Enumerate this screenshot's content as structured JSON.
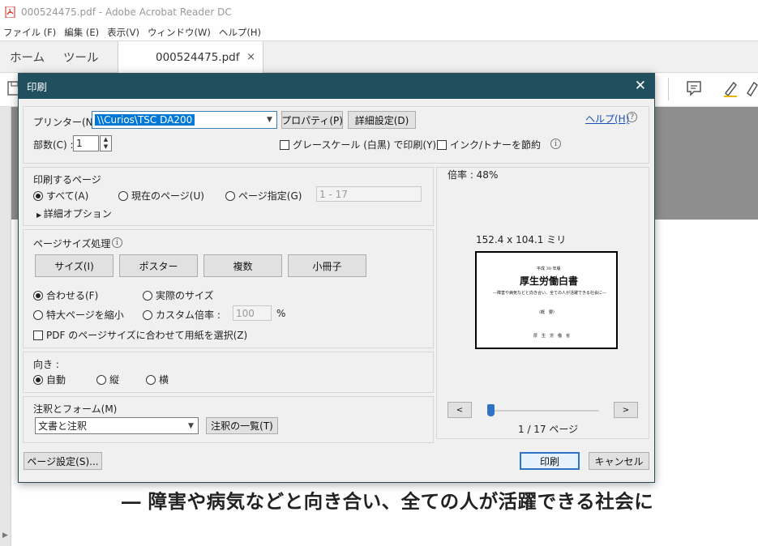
{
  "window": {
    "title": "000524475.pdf - Adobe Acrobat Reader DC"
  },
  "menu": [
    "ファイル (F)",
    "編集 (E)",
    "表示(V)",
    "ウィンドウ(W)",
    "ヘルプ(H)"
  ],
  "tabs": {
    "home": "ホーム",
    "tools": "ツール",
    "document": "000524475.pdf",
    "close": "×"
  },
  "document": {
    "visible_line": "― 障害や病気などと向き合い、全ての人が活躍できる社会に"
  },
  "dialog": {
    "title": "印刷",
    "close": "✕",
    "help_link": "ヘルプ(H)",
    "help_icon": "?",
    "printer": {
      "label": "プリンター(N) :",
      "value": "\\\\Curios\\TSC DA200",
      "properties_button": "プロパティ(P)",
      "advanced_button": "詳細設定(D)"
    },
    "copies": {
      "label": "部数(C) :",
      "value": "1"
    },
    "grayscale_label": "グレースケール (白黒) で印刷(Y)",
    "save_ink_label": "インク/トナーを節約",
    "pages_to_print": {
      "heading": "印刷するページ",
      "all": "すべて(A)",
      "current": "現在のページ(U)",
      "specify": "ページ指定(G)",
      "range_placeholder": "1 - 17",
      "more_options": "詳細オプション"
    },
    "page_sizing": {
      "heading": "ページサイズ処理",
      "buttons": [
        "サイズ(I)",
        "ポスター",
        "複数",
        "小冊子"
      ],
      "fit": "合わせる(F)",
      "actual_size": "実際のサイズ",
      "shrink": "特大ページを縮小",
      "custom_scale": "カスタム倍率 :",
      "custom_scale_value": "100",
      "percent": "%",
      "choose_paper": "PDF のページサイズに合わせて用紙を選択(Z)"
    },
    "orientation": {
      "heading": "向き :",
      "auto": "自動",
      "portrait": "縦",
      "landscape": "横"
    },
    "comments": {
      "heading": "注釈とフォーム(M)",
      "value": "文書と注釈",
      "summary_button": "注釈の一覧(T)"
    },
    "preview": {
      "scale": "倍率 : 48%",
      "dimensions": "152.4 x 104.1 ミリ",
      "page_counter": "1 / 17 ページ",
      "prev": "<",
      "next": ">",
      "thumb": {
        "line1": "平成 30 年版",
        "line2": "厚生労働白書",
        "line3": "―障害や病気などと向き合い、全ての人が活躍できる社会に―",
        "line4": "（概　要）",
        "line5": "厚　生　労　働　省"
      }
    },
    "page_setup_button": "ページ設定(S)...",
    "print_button": "印刷",
    "cancel_button": "キャンセル"
  },
  "colors": {
    "dialog_title_bg": "#20505e",
    "accent": "#2f74c4",
    "selection": "#0078d7"
  }
}
